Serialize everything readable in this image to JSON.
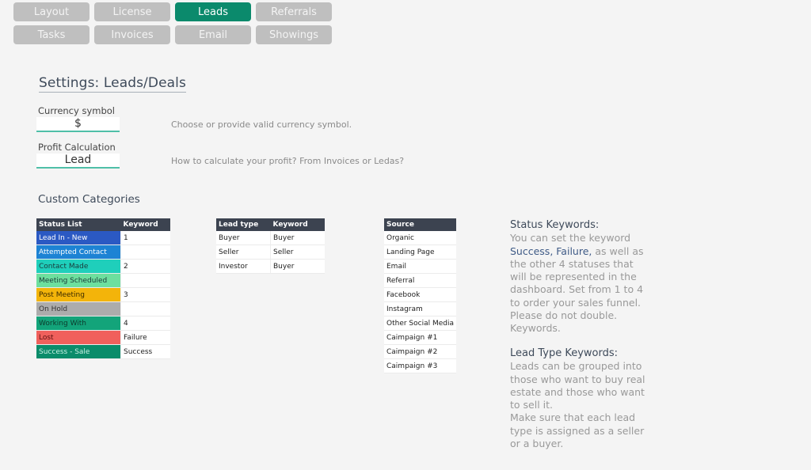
{
  "nav": {
    "buttons": [
      {
        "label": "Layout",
        "active": false
      },
      {
        "label": "License",
        "active": false
      },
      {
        "label": "Leads",
        "active": true
      },
      {
        "label": "Referrals",
        "active": false
      },
      {
        "label": "Tasks",
        "active": false
      },
      {
        "label": "Invoices",
        "active": false
      },
      {
        "label": "Email",
        "active": false
      },
      {
        "label": "Showings",
        "active": false
      }
    ],
    "active_color": "#0b8a6c",
    "inactive_color": "#bfbfbf"
  },
  "page_title": "Settings: Leads/Deals",
  "settings": {
    "currency": {
      "label": "Currency symbol",
      "value": "$",
      "hint": "Choose or provide valid currency symbol."
    },
    "profit": {
      "label": "Profit Calculation",
      "value": "Lead",
      "hint": "How to calculate your profit? From Invoices or Ledas?"
    }
  },
  "custom_categories": {
    "title": "Custom Categories",
    "status_table": {
      "headers": [
        "Status List",
        "Keyword"
      ],
      "rows": [
        {
          "status": "Lead In - New",
          "keyword": "1",
          "color": "#2b59c3",
          "text_color": "#ffffff"
        },
        {
          "status": "Attempted Contact",
          "keyword": "",
          "color": "#1d83d4",
          "text_color": "#ffffff"
        },
        {
          "status": "Contact Made",
          "keyword": "2",
          "color": "#1fcfbb",
          "text_color": "#1a3a3a"
        },
        {
          "status": "Meeting Scheduled",
          "keyword": "",
          "color": "#6ddf9e",
          "text_color": "#1a3a3a"
        },
        {
          "status": "Post Meeting",
          "keyword": "3",
          "color": "#f3b40a",
          "text_color": "#3a2a00"
        },
        {
          "status": "On Hold",
          "keyword": "",
          "color": "#acacac",
          "text_color": "#333333"
        },
        {
          "status": "Working With",
          "keyword": "4",
          "color": "#13a47a",
          "text_color": "#0d3a2c"
        },
        {
          "status": "Lost",
          "keyword": "Failure",
          "color": "#f0605c",
          "text_color": "#5a1010"
        },
        {
          "status": "Success - Sale",
          "keyword": "Success",
          "color": "#0a8c6a",
          "text_color": "#c8f0e4"
        }
      ]
    },
    "lead_table": {
      "headers": [
        "Lead type",
        "Keyword"
      ],
      "rows": [
        {
          "type": "Buyer",
          "keyword": "Buyer"
        },
        {
          "type": "Seller",
          "keyword": "Seller"
        },
        {
          "type": "Investor",
          "keyword": "Buyer"
        }
      ]
    },
    "source_table": {
      "headers": [
        "Source"
      ],
      "rows": [
        "Organic",
        "Landing Page",
        "Email",
        "Referral",
        "Facebook",
        "Instagram",
        "Other Social Media",
        "Caimpaign #1",
        "Caimpaign #2",
        "Caimpaign #3"
      ]
    }
  },
  "info": {
    "status_heading": "Status Keywords:",
    "status_text_1": "You can set the keyword",
    "status_emphasis": "Success, Failure,",
    "status_text_2": "as well as the other 4 statuses that will be represented in the dashboard. Set from 1 to 4 to order your sales funnel. Please do not double. Keywords.",
    "lead_heading": "Lead Type Keywords:",
    "lead_text_1": "Leads can be grouped into those who want to buy real estate and those who want to sell it.",
    "lead_text_2": "Make sure that each lead type is assigned as a seller or a buyer."
  }
}
